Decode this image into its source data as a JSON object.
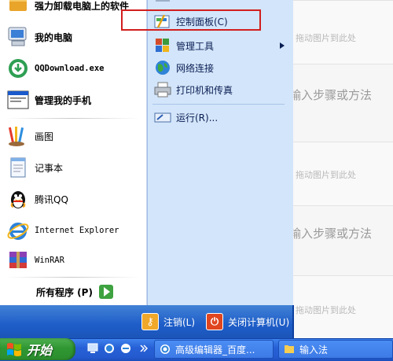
{
  "start_menu": {
    "left_items": [
      {
        "label": "强力卸载电脑上的软件",
        "icon": "uninstall-box-icon"
      },
      {
        "label": "我的电脑",
        "icon": "my-computer-icon"
      },
      {
        "label": "QQDownload.exe",
        "icon": "qq-download-icon"
      },
      {
        "label": "管理我的手机",
        "icon": "phone-manager-icon"
      },
      {
        "label": "画图",
        "icon": "paint-icon"
      },
      {
        "label": "记事本",
        "icon": "notepad-icon"
      },
      {
        "label": "腾讯QQ",
        "icon": "qq-penguin-icon"
      },
      {
        "label": "Internet Explorer",
        "icon": "internet-explorer-icon"
      },
      {
        "label": "WinRAR",
        "icon": "winrar-icon"
      }
    ],
    "all_programs": "所有程序 (P)",
    "right_items": [
      {
        "label": "控制面板(C)",
        "icon": "control-panel-icon"
      },
      {
        "label": "管理工具",
        "icon": "admin-tools-icon"
      },
      {
        "label": "网络连接",
        "icon": "network-globe-icon"
      },
      {
        "label": "打印机和传真",
        "icon": "printer-icon"
      },
      {
        "label": "运行(R)...",
        "icon": "run-icon"
      }
    ],
    "logoff": "注销(L)",
    "shutdown": "关闭计算机(U)"
  },
  "background_page": {
    "drop_hint": "拖动图片到此处",
    "step_hint": "输入步骤或方法"
  },
  "taskbar": {
    "start_label": "开始",
    "tasks": [
      {
        "label": "高级编辑器_百度...",
        "icon": "ie-task-icon"
      },
      {
        "label": "输入法",
        "icon": "folder-task-icon"
      }
    ]
  },
  "colors": {
    "highlight_border": "#d21e1e",
    "right_panel": "#d3e5fa",
    "footer": "#1e5dc8",
    "start_button": "#2f9732"
  }
}
